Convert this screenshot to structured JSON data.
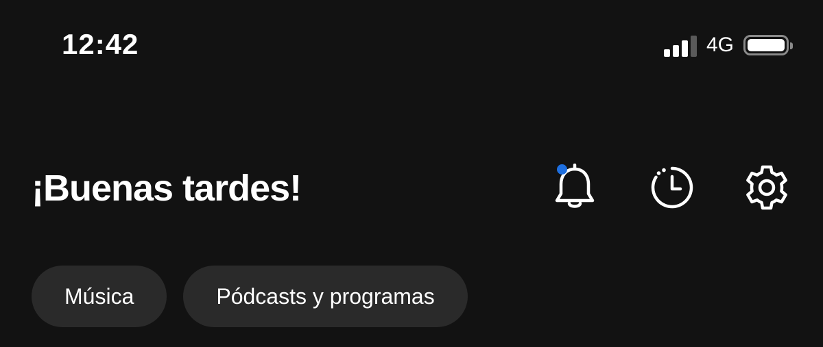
{
  "status_bar": {
    "time": "12:42",
    "network": "4G",
    "signal_bars_active": 3,
    "signal_bars_total": 4,
    "battery_level": 1.0
  },
  "header": {
    "greeting": "¡Buenas tardes!",
    "icons": [
      "bell-icon",
      "recent-history-icon",
      "gear-icon"
    ],
    "notification_dot_color": "#1e6fe0"
  },
  "chips": [
    {
      "label": "Música"
    },
    {
      "label": "Pódcasts y programas"
    }
  ],
  "colors": {
    "background": "#121212",
    "chip_background": "#2a2a2a",
    "text": "#ffffff"
  }
}
